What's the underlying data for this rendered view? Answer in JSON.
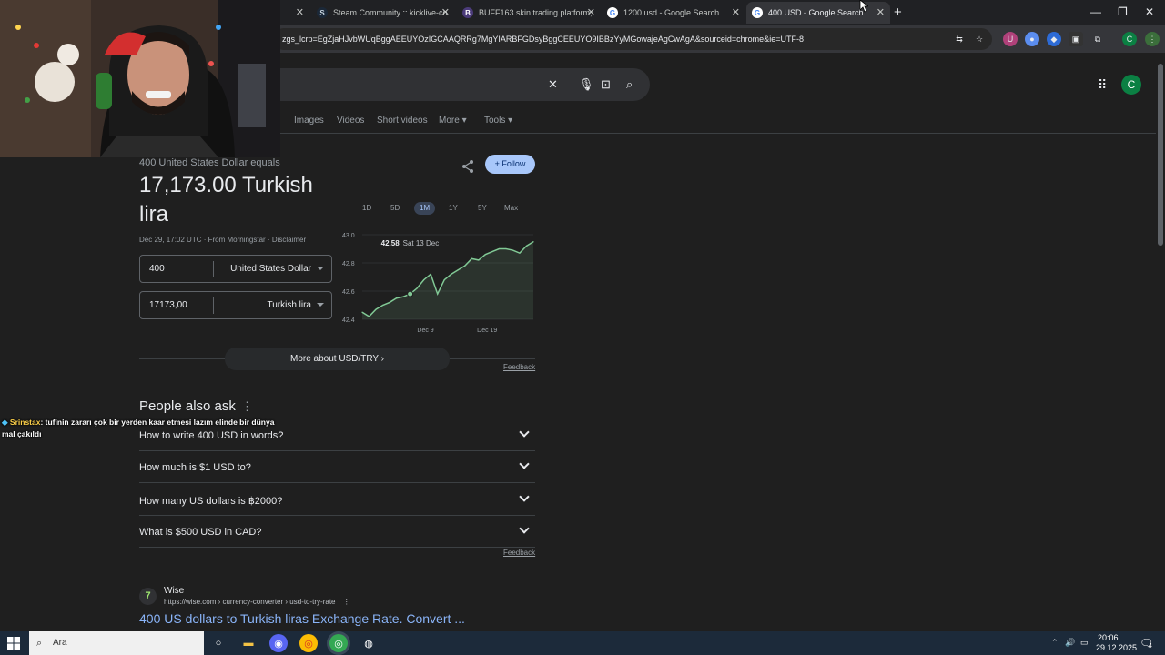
{
  "browser": {
    "tabs": [
      {
        "title": "s",
        "favicon": "steam-icon",
        "active": false
      },
      {
        "title": "Steam Community :: kicklive-co",
        "favicon": "steam-icon",
        "active": false
      },
      {
        "title": "BUFF163 skin trading platform,",
        "favicon": "buff-icon",
        "active": false
      },
      {
        "title": "1200 usd - Google Search",
        "favicon": "google-icon",
        "active": false
      },
      {
        "title": "400 USD - Google Search",
        "favicon": "google-icon",
        "active": true
      }
    ],
    "new_tab": "+",
    "url": "zgs_lcrp=EgZjaHJvbWUqBggAEEUYOzIGCAAQRRg7MgYIARBFGDsyBggCEEUYO9IBBzYyMGowajeAgCwAgA&sourceid=chrome&ie=UTF-8",
    "profile_initial": "C"
  },
  "search": {
    "filters": [
      "Images",
      "Videos",
      "Short videos",
      "More",
      "Tools"
    ],
    "avatar_initial": "C"
  },
  "converter": {
    "equals_label": "400 United States Dollar equals",
    "result": "17,173.00 Turkish lira",
    "meta": "Dec 29, 17:02 UTC · From Morningstar · Disclaimer",
    "from_value": "400",
    "from_currency": "United States Dollar",
    "to_value": "17173,00",
    "to_currency": "Turkish lira",
    "follow_label": "Follow",
    "ranges": [
      "1D",
      "5D",
      "1M",
      "1Y",
      "5Y",
      "Max"
    ],
    "selected_range": "1M",
    "more_button": "More about USD/TRY",
    "feedback": "Feedback"
  },
  "chart_data": {
    "type": "line",
    "title": "",
    "xlabel": "",
    "ylabel": "",
    "ylim": [
      42.4,
      43.0
    ],
    "yticks": [
      "43.0",
      "42.8",
      "42.6",
      "42.4"
    ],
    "xticks": [
      "Dec 9",
      "Dec 19"
    ],
    "tooltip": {
      "value": "42.58",
      "date": "Sat 13 Dec"
    },
    "series": [
      {
        "values": [
          42.45,
          42.42,
          42.47,
          42.5,
          42.52,
          42.55,
          42.56,
          42.58,
          42.62,
          42.68,
          42.72,
          42.58,
          42.68,
          42.72,
          42.75,
          42.78,
          42.83,
          42.82,
          42.86,
          42.88,
          42.9,
          42.9,
          42.89,
          42.87,
          42.92,
          42.95
        ]
      }
    ],
    "color": "#81c995"
  },
  "people_also_ask": {
    "title": "People also ask",
    "questions": [
      "How to write 400 USD in words?",
      "How much is $1 USD to?",
      "How many US dollars is ฿2000?",
      "What is $500 USD in CAD?"
    ],
    "feedback": "Feedback"
  },
  "result_wise": {
    "name": "Wise",
    "url": "https://wise.com › currency-converter › usd-to-try-rate",
    "title": "400 US dollars to Turkish liras Exchange Rate. Convert ..."
  },
  "chat": {
    "user": "Srinstax",
    "message": ": tufinin zararı çok bir yerden kaar etmesi lazım elinde bir dünya mal çakıldı"
  },
  "taskbar": {
    "search_placeholder": "Ara",
    "time": "20:06",
    "date": "29.12.2025",
    "notification_count": "4"
  },
  "colors": {
    "accent": "#a8c7fa",
    "link": "#8ab4f8",
    "chart_line": "#81c995"
  }
}
